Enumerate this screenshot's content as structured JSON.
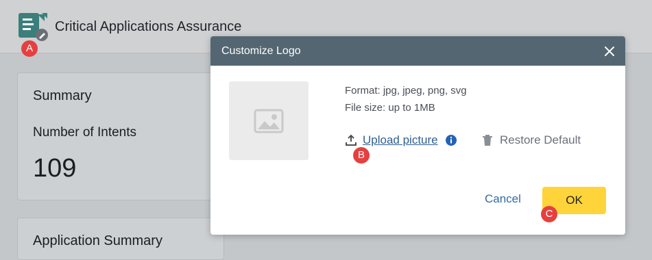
{
  "app": {
    "title": "Critical Applications Assurance"
  },
  "summary_card": {
    "title": "Summary",
    "label": "Number of Intents",
    "value": "109"
  },
  "app_summary_card": {
    "title": "Application Summary"
  },
  "badges": {
    "a": "A",
    "b": "B",
    "c": "C"
  },
  "dialog": {
    "title": "Customize Logo",
    "format_text": "Format: jpg, jpeg, png, svg",
    "size_text": "File size: up to 1MB",
    "upload_label": "Upload picture",
    "restore_label": "Restore Default",
    "cancel_label": "Cancel",
    "ok_label": "OK"
  },
  "colors": {
    "dialog_header": "#546672",
    "ok_button": "#ffd43b",
    "badge": "#e5403f",
    "link": "#2f5f8f"
  },
  "icons": [
    "app-logo-icon",
    "edit-pencil-icon",
    "close-icon",
    "image-placeholder-icon",
    "upload-icon",
    "info-icon",
    "trash-icon"
  ]
}
